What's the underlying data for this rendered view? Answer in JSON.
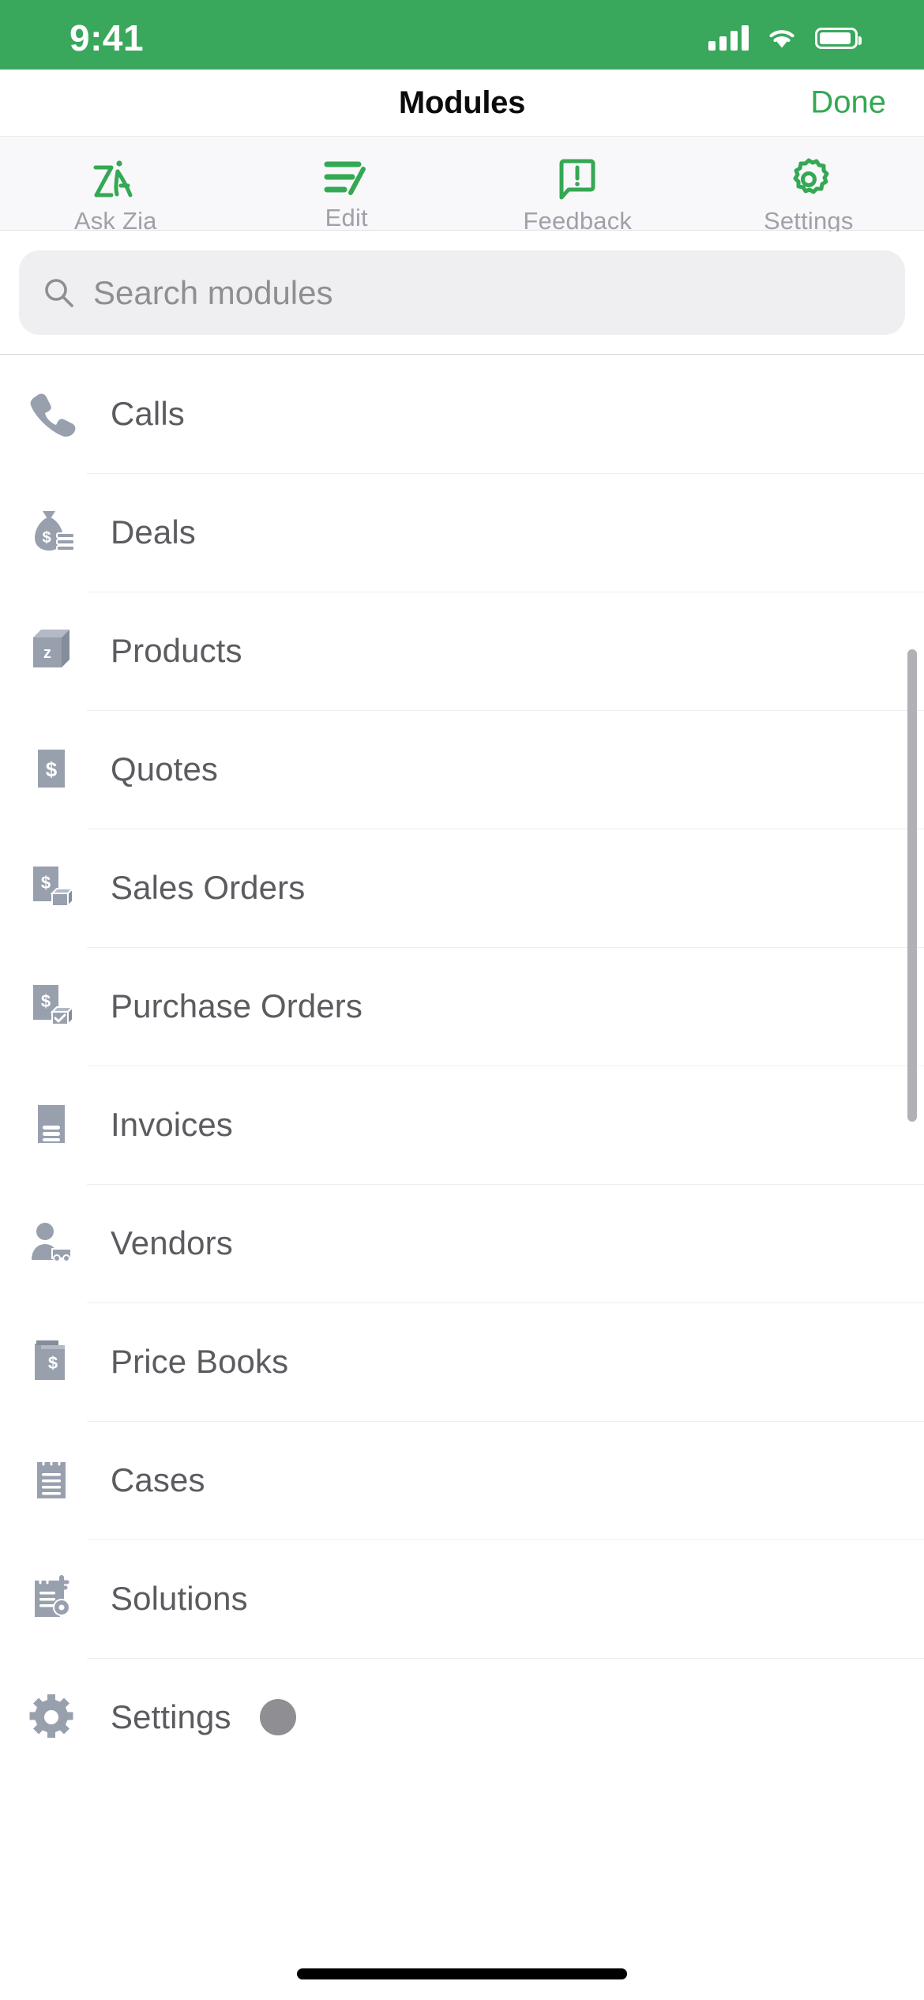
{
  "status_bar": {
    "time": "9:41",
    "cellular_icon": "signal-bars-icon",
    "wifi_icon": "wifi-icon",
    "battery_icon": "battery-icon",
    "background_color": "#39a85c"
  },
  "nav_bar": {
    "title": "Modules",
    "done_label": "Done",
    "accent_color": "#34a853"
  },
  "toolbar": {
    "items": [
      {
        "label": "Ask Zia",
        "icon": "zia-icon"
      },
      {
        "label": "Edit",
        "icon": "edit-list-icon"
      },
      {
        "label": "Feedback",
        "icon": "feedback-bubble-icon"
      },
      {
        "label": "Settings",
        "icon": "gear-icon"
      }
    ]
  },
  "search": {
    "placeholder": "Search modules",
    "value": "",
    "icon": "search-icon"
  },
  "modules": {
    "items": [
      {
        "label": "Calls",
        "icon": "phone-icon"
      },
      {
        "label": "Deals",
        "icon": "money-bag-icon"
      },
      {
        "label": "Products",
        "icon": "product-box-icon"
      },
      {
        "label": "Quotes",
        "icon": "dollar-document-icon"
      },
      {
        "label": "Sales Orders",
        "icon": "dollar-document-box-icon"
      },
      {
        "label": "Purchase Orders",
        "icon": "dollar-document-checked-box-icon"
      },
      {
        "label": "Invoices",
        "icon": "invoice-document-icon"
      },
      {
        "label": "Vendors",
        "icon": "person-truck-icon"
      },
      {
        "label": "Price Books",
        "icon": "price-book-icon"
      },
      {
        "label": "Cases",
        "icon": "notepad-icon"
      },
      {
        "label": "Solutions",
        "icon": "notepad-key-icon"
      },
      {
        "label": "Settings",
        "icon": "gear-solid-icon"
      }
    ],
    "icon_color": "#98a0ae",
    "label_color": "#5b5b60"
  },
  "touch_indicator": {
    "name": "touch-point-indicator",
    "color": "#8e8e93"
  },
  "scrollbar": {
    "name": "vertical-scrollbar",
    "color": "#b0b0b5"
  },
  "home_indicator": {
    "name": "home-indicator"
  }
}
